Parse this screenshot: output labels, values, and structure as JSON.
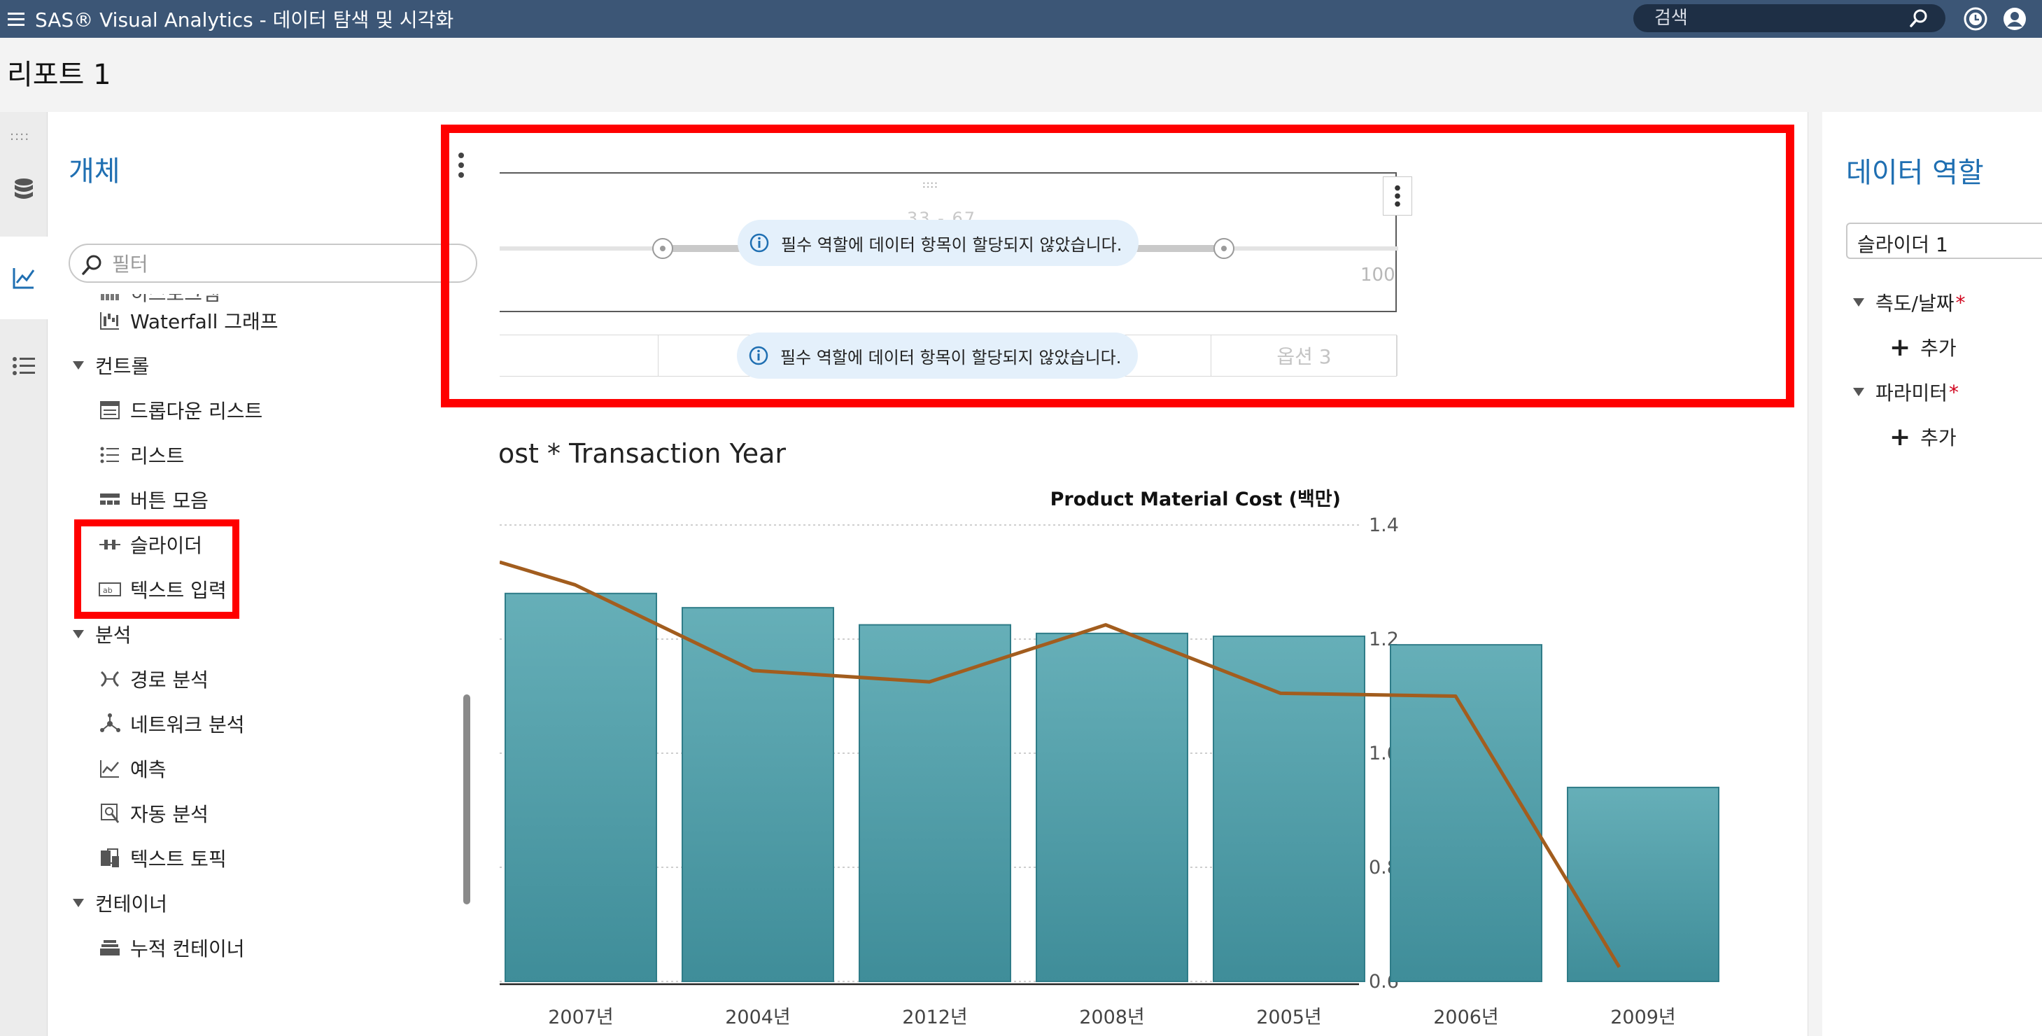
{
  "app": {
    "title": "SAS® Visual Analytics - 데이터 탐색 및 시각화",
    "search_placeholder": "검색"
  },
  "report": {
    "title": "리포트 1"
  },
  "rail": {
    "items": [
      {
        "name": "data-icon"
      },
      {
        "name": "objects-icon",
        "active": true
      },
      {
        "name": "outline-icon"
      }
    ]
  },
  "objects_panel": {
    "title": "개체",
    "filter_placeholder": "필터",
    "partial_item": "히스토그램",
    "items_top": [
      {
        "label": "Waterfall 그래프",
        "icon": "waterfall-chart-icon"
      }
    ],
    "categories": [
      {
        "label": "컨트롤",
        "items": [
          {
            "label": "드롭다운 리스트",
            "icon": "dropdown-list-icon"
          },
          {
            "label": "리스트",
            "icon": "list-icon"
          },
          {
            "label": "버튼 모음",
            "icon": "button-bar-icon"
          },
          {
            "label": "슬라이더",
            "icon": "slider-icon"
          },
          {
            "label": "텍스트 입력",
            "icon": "text-input-icon"
          }
        ]
      },
      {
        "label": "분석",
        "items": [
          {
            "label": "경로 분석",
            "icon": "path-analysis-icon"
          },
          {
            "label": "네트워크 분석",
            "icon": "network-analysis-icon"
          },
          {
            "label": "예측",
            "icon": "forecast-icon"
          },
          {
            "label": "자동 분석",
            "icon": "auto-analysis-icon"
          },
          {
            "label": "텍스트 토픽",
            "icon": "text-topics-icon"
          }
        ]
      },
      {
        "label": "컨테이너",
        "items": [
          {
            "label": "누적 컨테이너",
            "icon": "stack-container-icon"
          }
        ]
      }
    ]
  },
  "canvas": {
    "slider_faded_text": "33 - 67",
    "slider_max": "100",
    "notice": "필수 역할에 데이터 항목이 할당되지 않았습니다.",
    "button_bar_option": "옵션 3",
    "highlight_color": "#ff0000"
  },
  "chart_data": {
    "type": "bar",
    "title": "ost * Transaction Year",
    "categories": [
      "2007년",
      "2004년",
      "2012년",
      "2008년",
      "2005년",
      "2006년",
      "2009년"
    ],
    "series": [
      {
        "kind": "bar",
        "values": [
          1.28,
          1.255,
          1.225,
          1.21,
          1.205,
          1.19,
          0.94
        ],
        "color": "#4a9aa5"
      },
      {
        "kind": "line",
        "values": [
          1.295,
          1.145,
          1.125,
          1.225,
          1.105,
          1.1,
          0.625
        ],
        "color": "#a25d1e"
      }
    ],
    "line_start_value": 1.335,
    "y2label": "Product Material Cost (백만)",
    "y2ticks": [
      1.4,
      1.2,
      1.0,
      0.8,
      0.6
    ],
    "y2lim": [
      0.6,
      1.4
    ],
    "grid": true
  },
  "roles_panel": {
    "title": "데이터 역할",
    "selected": "슬라이더 1",
    "sections": [
      {
        "label": "측도/날짜",
        "required": "*",
        "add_label": "추가"
      },
      {
        "label": "파라미터",
        "required": "*",
        "add_label": "추가"
      }
    ]
  }
}
